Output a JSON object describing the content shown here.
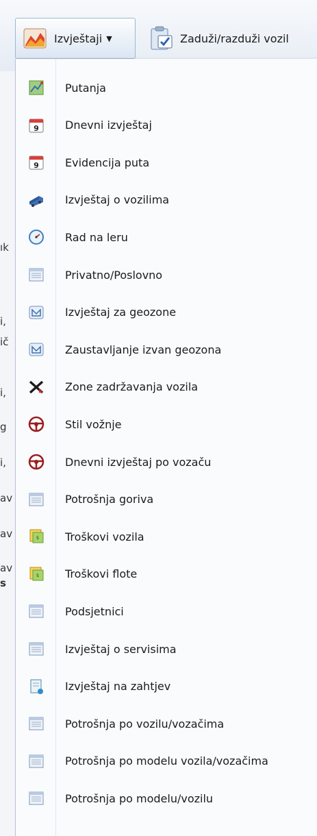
{
  "toolbar": {
    "reports_label": "Izvještaji",
    "reports_icon": "report-chart-icon",
    "assign_label": "Zaduži/razduži vozil",
    "assign_icon": "clipboard-check-icon"
  },
  "background_fragments": [
    "ık",
    "i,",
    "ič",
    "i,",
    "g",
    "i,",
    "av",
    "av",
    "av",
    "s"
  ],
  "menu": {
    "items": [
      {
        "label": "Putanja",
        "icon": "map-route-icon"
      },
      {
        "label": "Dnevni izvještaj",
        "icon": "calendar-icon"
      },
      {
        "label": "Evidencija puta",
        "icon": "calendar-icon"
      },
      {
        "label": "Izvještaj o vozilima",
        "icon": "truck-icon"
      },
      {
        "label": "Rad na leru",
        "icon": "speedometer-icon"
      },
      {
        "label": "Privatno/Poslovno",
        "icon": "list-icon"
      },
      {
        "label": "Izvještaj za geozone",
        "icon": "geozone-icon"
      },
      {
        "label": "Zaustavljanje izvan geozona",
        "icon": "geozone-icon"
      },
      {
        "label": "Zone zadržavanja vozila",
        "icon": "cross-arrows-icon"
      },
      {
        "label": "Stil vožnje",
        "icon": "steering-wheel-icon"
      },
      {
        "label": "Dnevni izvještaj po vozaču",
        "icon": "steering-wheel-icon"
      },
      {
        "label": "Potrošnja goriva",
        "icon": "list-icon"
      },
      {
        "label": "Troškovi vozila",
        "icon": "notes-icon"
      },
      {
        "label": "Troškovi flote",
        "icon": "notes-icon"
      },
      {
        "label": "Podsjetnici",
        "icon": "list-icon"
      },
      {
        "label": "Izvještaj o servisima",
        "icon": "list-icon"
      },
      {
        "label": "Izvještaj na zahtjev",
        "icon": "document-icon"
      },
      {
        "label": "Potrošnja po vozilu/vozačima",
        "icon": "list-icon"
      },
      {
        "label": "Potrošnja po modelu vozila/vozačima",
        "icon": "list-icon"
      },
      {
        "label": "Potrošnja po modelu/vozilu",
        "icon": "list-icon"
      }
    ]
  }
}
